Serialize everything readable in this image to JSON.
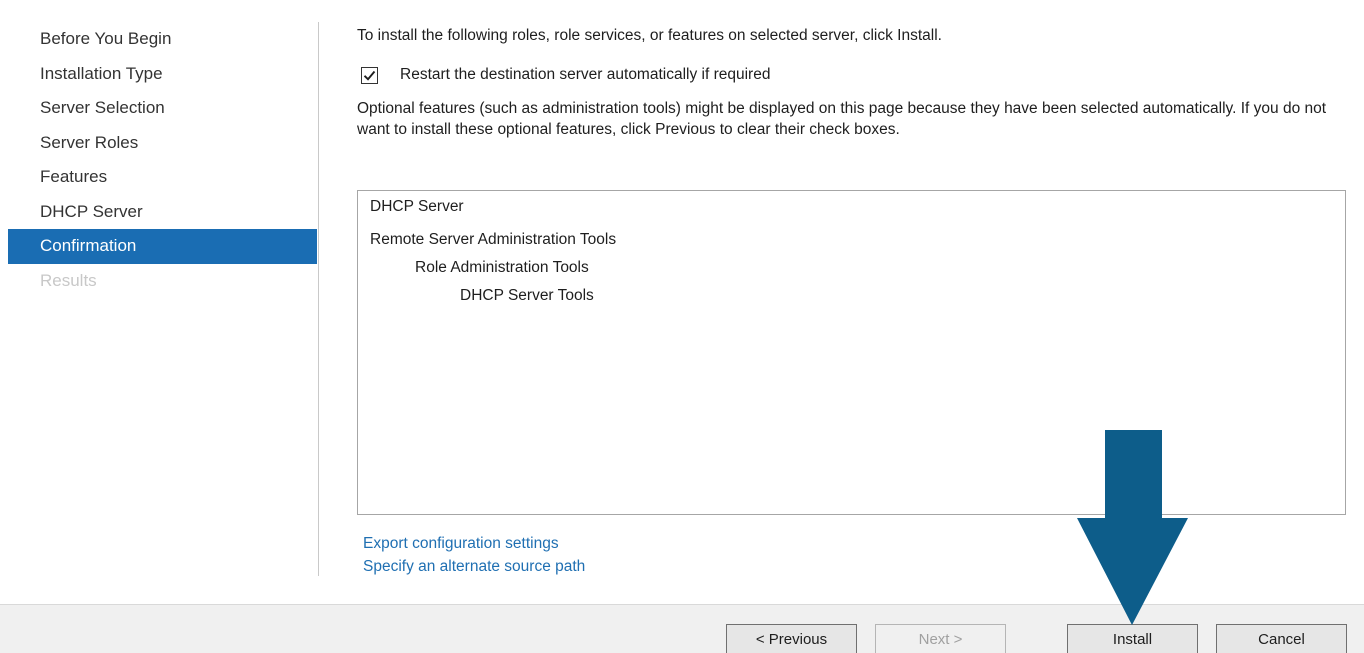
{
  "nav": {
    "items": [
      {
        "label": "Before You Begin",
        "state": "normal"
      },
      {
        "label": "Installation Type",
        "state": "normal"
      },
      {
        "label": "Server Selection",
        "state": "normal"
      },
      {
        "label": "Server Roles",
        "state": "normal"
      },
      {
        "label": "Features",
        "state": "normal"
      },
      {
        "label": "DHCP Server",
        "state": "normal"
      },
      {
        "label": "Confirmation",
        "state": "active"
      },
      {
        "label": "Results",
        "state": "disabled"
      }
    ]
  },
  "main": {
    "intro": "To install the following roles, role services, or features on selected server, click Install.",
    "restart_checkbox": {
      "label": "Restart the destination server automatically if required",
      "checked": true
    },
    "optional_note": "Optional features (such as administration tools) might be displayed on this page because they have been selected automatically. If you do not want to install these optional features, click Previous to clear their check boxes.",
    "features": [
      "DHCP Server",
      "Remote Server Administration Tools",
      "Role Administration Tools",
      "DHCP Server Tools"
    ],
    "links": {
      "export": "Export configuration settings",
      "alternate_source": "Specify an alternate source path"
    }
  },
  "footer": {
    "previous": "< Previous",
    "next": "Next >",
    "install": "Install",
    "cancel": "Cancel"
  },
  "colors": {
    "active_nav": "#1a6db3",
    "link": "#1f6fb2",
    "arrow": "#0d5d8a"
  },
  "icons": {
    "checkmark": "checkmark-icon",
    "arrow": "down-arrow-icon"
  }
}
